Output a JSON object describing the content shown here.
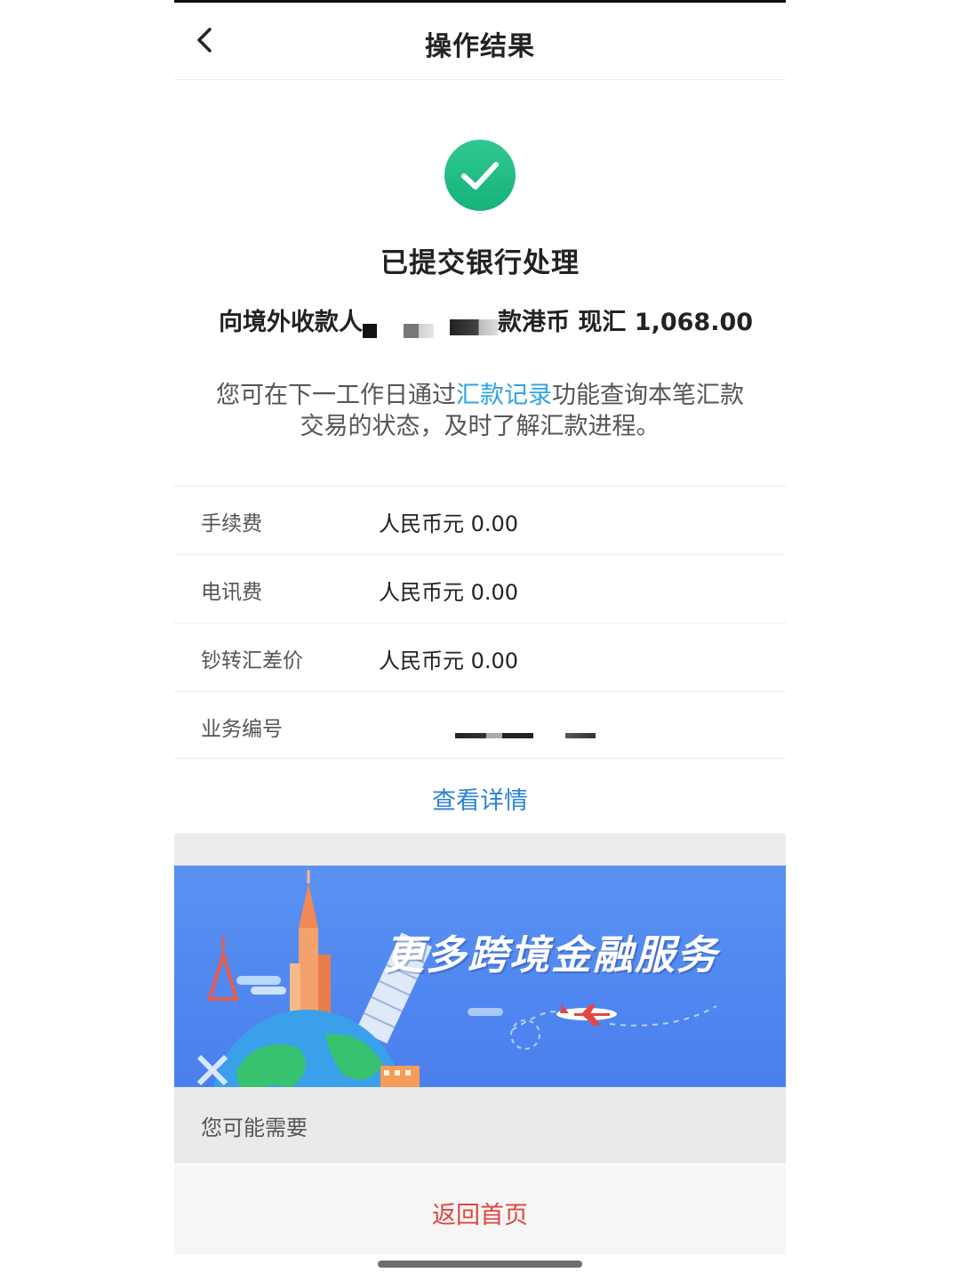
{
  "nav": {
    "title": "操作结果",
    "back_icon": "chevron-left-icon"
  },
  "result": {
    "status_title": "已提交银行处理",
    "icon": "check-circle-icon",
    "accent_color": "#1fbd85",
    "summary_prefix": "向境外收款人",
    "summary_suffix": "款港币 现汇 1,068.00"
  },
  "notice": {
    "before_link": "您可在下一工作日通过",
    "link": "汇款记录",
    "after_link_line1": "功能查询本笔汇款",
    "line2": "交易的状态，及时了解汇款进程。",
    "link_color": "#2ea4e6"
  },
  "rows": [
    {
      "label": "手续费",
      "value": "人民币元 0.00"
    },
    {
      "label": "电讯费",
      "value": "人民币元 0.00"
    },
    {
      "label": "钞转汇差价",
      "value": "人民币元 0.00"
    },
    {
      "label": "业务编号",
      "value": ""
    }
  ],
  "actions": {
    "view_details": "查看详情",
    "view_details_color": "#2b82d6",
    "return_home": "返回首页",
    "return_home_color": "#e0463c"
  },
  "banner": {
    "title": "更多跨境金融服务",
    "background": "#4f86ef"
  },
  "recommend": {
    "label": "您可能需要"
  }
}
